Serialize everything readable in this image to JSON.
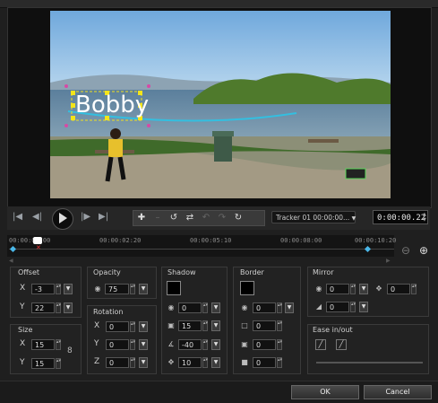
{
  "preview": {
    "overlay_text": "Bobby"
  },
  "controls": {
    "tracker_label": "Tracker 01",
    "tracker_time": "00:00:00...",
    "timecode": "0:00:00.22"
  },
  "timeline": {
    "ticks": [
      "00:00:00:00",
      "00:00:02:20",
      "00:00:05:10",
      "00:00:08:00",
      "00:00:10:20"
    ]
  },
  "offset": {
    "title": "Offset",
    "x_label": "X",
    "x": "-3",
    "y_label": "Y",
    "y": "22"
  },
  "size": {
    "title": "Size",
    "x_label": "X",
    "x": "15",
    "y_label": "Y",
    "y": "15"
  },
  "opacity": {
    "title": "Opacity",
    "value": "75"
  },
  "rotation": {
    "title": "Rotation",
    "x_label": "X",
    "x": "0",
    "y_label": "Y",
    "y": "0",
    "z_label": "Z",
    "z": "0"
  },
  "shadow": {
    "title": "Shadow",
    "color": "#000000",
    "opacity": "0",
    "blur": "15",
    "angle": "-40",
    "distance": "10"
  },
  "border": {
    "title": "Border",
    "color": "#000000",
    "opacity": "0",
    "width": "0",
    "v2": "0",
    "v3": "0"
  },
  "mirror": {
    "title": "Mirror",
    "opacity": "0",
    "offset": "0",
    "fade": "0"
  },
  "ease": {
    "title": "Ease in/out"
  },
  "footer": {
    "ok": "OK",
    "cancel": "Cancel"
  }
}
